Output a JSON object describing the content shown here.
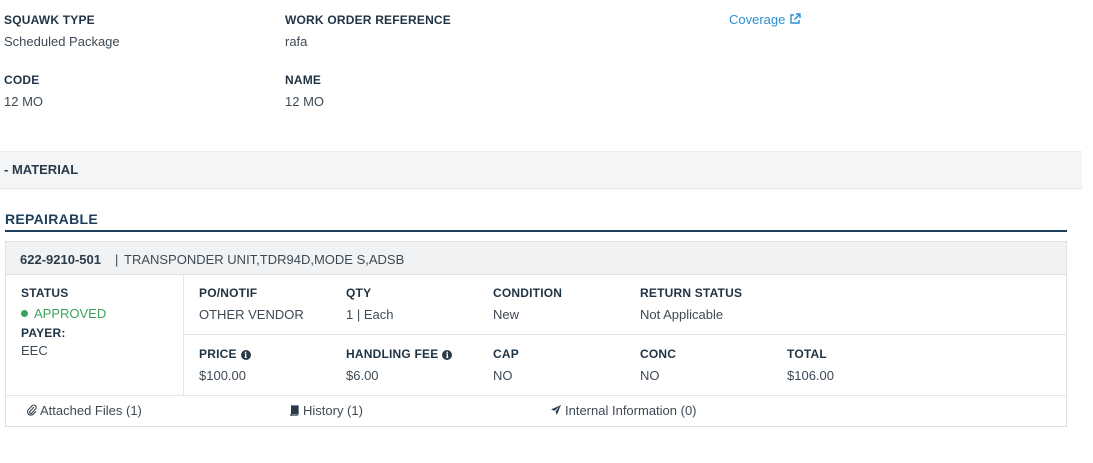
{
  "header": {
    "squawk_type": {
      "label": "SQUAWK TYPE",
      "value": "Scheduled Package"
    },
    "work_order_reference": {
      "label": "WORK ORDER REFERENCE",
      "value": "rafa"
    },
    "coverage_link": "Coverage",
    "code": {
      "label": "CODE",
      "value": "12 MO"
    },
    "name": {
      "label": "NAME",
      "value": "12 MO"
    }
  },
  "section": {
    "title": "- MATERIAL"
  },
  "repairable": {
    "title": "REPAIRABLE",
    "part_number": "622-9210-501",
    "separator": "|",
    "description": "TRANSPONDER UNIT,TDR94D,MODE S,ADSB",
    "status": {
      "label": "STATUS",
      "value": "APPROVED",
      "color": "#3aa35a"
    },
    "payer": {
      "label": "PAYER:",
      "value": "EEC"
    },
    "po_notif": {
      "label": "PO/NOTIF",
      "value": "OTHER VENDOR"
    },
    "qty": {
      "label": "QTY",
      "value": "1 | Each"
    },
    "condition": {
      "label": "CONDITION",
      "value": "New"
    },
    "return_status": {
      "label": "RETURN STATUS",
      "value": "Not Applicable"
    },
    "price": {
      "label": "PRICE",
      "value": "$100.00",
      "icon": "info-icon"
    },
    "handling_fee": {
      "label": "HANDLING FEE",
      "value": "$6.00",
      "icon": "info-icon"
    },
    "cap": {
      "label": "CAP",
      "value": "NO"
    },
    "conc": {
      "label": "CONC",
      "value": "NO"
    },
    "total": {
      "label": "TOTAL",
      "value": "$106.00"
    }
  },
  "footer": {
    "attached_files": "Attached Files (1)",
    "history": "History (1)",
    "internal_information": "Internal Information (0)"
  },
  "colors": {
    "accent_link": "#2a8fd0",
    "heading": "#1d3d5c",
    "approved": "#3aa35a"
  }
}
